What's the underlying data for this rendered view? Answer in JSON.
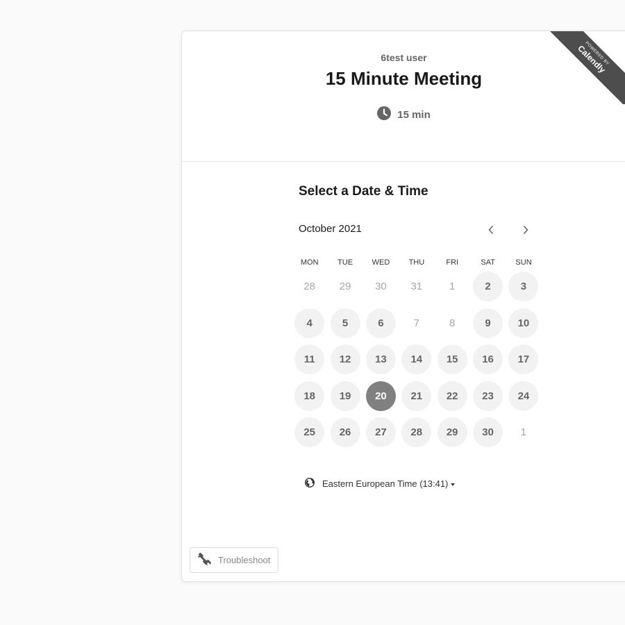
{
  "header": {
    "host": "6test user",
    "title": "15 Minute Meeting",
    "duration": "15 min",
    "ribbon_small": "POWERED BY",
    "ribbon_big": "Calendly"
  },
  "calendar": {
    "heading": "Select a Date & Time",
    "month": "October 2021",
    "prev_icon": "chevron-left-icon",
    "next_icon": "chevron-right-icon",
    "weekdays": [
      "MON",
      "TUE",
      "WED",
      "THU",
      "FRI",
      "SAT",
      "SUN"
    ],
    "weeks": [
      [
        {
          "d": "28",
          "s": "muted"
        },
        {
          "d": "29",
          "s": "muted"
        },
        {
          "d": "30",
          "s": "muted"
        },
        {
          "d": "31",
          "s": "muted"
        },
        {
          "d": "1",
          "s": "muted"
        },
        {
          "d": "2",
          "s": "avail"
        },
        {
          "d": "3",
          "s": "avail"
        }
      ],
      [
        {
          "d": "4",
          "s": "avail"
        },
        {
          "d": "5",
          "s": "avail"
        },
        {
          "d": "6",
          "s": "avail"
        },
        {
          "d": "7",
          "s": "muted"
        },
        {
          "d": "8",
          "s": "muted"
        },
        {
          "d": "9",
          "s": "avail"
        },
        {
          "d": "10",
          "s": "avail"
        }
      ],
      [
        {
          "d": "11",
          "s": "avail"
        },
        {
          "d": "12",
          "s": "avail"
        },
        {
          "d": "13",
          "s": "avail"
        },
        {
          "d": "14",
          "s": "avail"
        },
        {
          "d": "15",
          "s": "avail"
        },
        {
          "d": "16",
          "s": "avail"
        },
        {
          "d": "17",
          "s": "avail"
        }
      ],
      [
        {
          "d": "18",
          "s": "avail"
        },
        {
          "d": "19",
          "s": "avail"
        },
        {
          "d": "20",
          "s": "selected"
        },
        {
          "d": "21",
          "s": "avail"
        },
        {
          "d": "22",
          "s": "avail"
        },
        {
          "d": "23",
          "s": "avail"
        },
        {
          "d": "24",
          "s": "avail"
        }
      ],
      [
        {
          "d": "25",
          "s": "avail"
        },
        {
          "d": "26",
          "s": "avail"
        },
        {
          "d": "27",
          "s": "avail"
        },
        {
          "d": "28",
          "s": "avail"
        },
        {
          "d": "29",
          "s": "avail"
        },
        {
          "d": "30",
          "s": "avail"
        },
        {
          "d": "1",
          "s": "muted"
        }
      ]
    ]
  },
  "timezone": {
    "label": "Eastern European Time (13:41)",
    "icon": "globe-icon"
  },
  "troubleshoot": {
    "label": "Troubleshoot",
    "icon": "wrench-icon"
  },
  "colors": {
    "selected_day": "#808080",
    "available_day_bg": "#f2f2f2",
    "ribbon": "#4d4d4d"
  }
}
